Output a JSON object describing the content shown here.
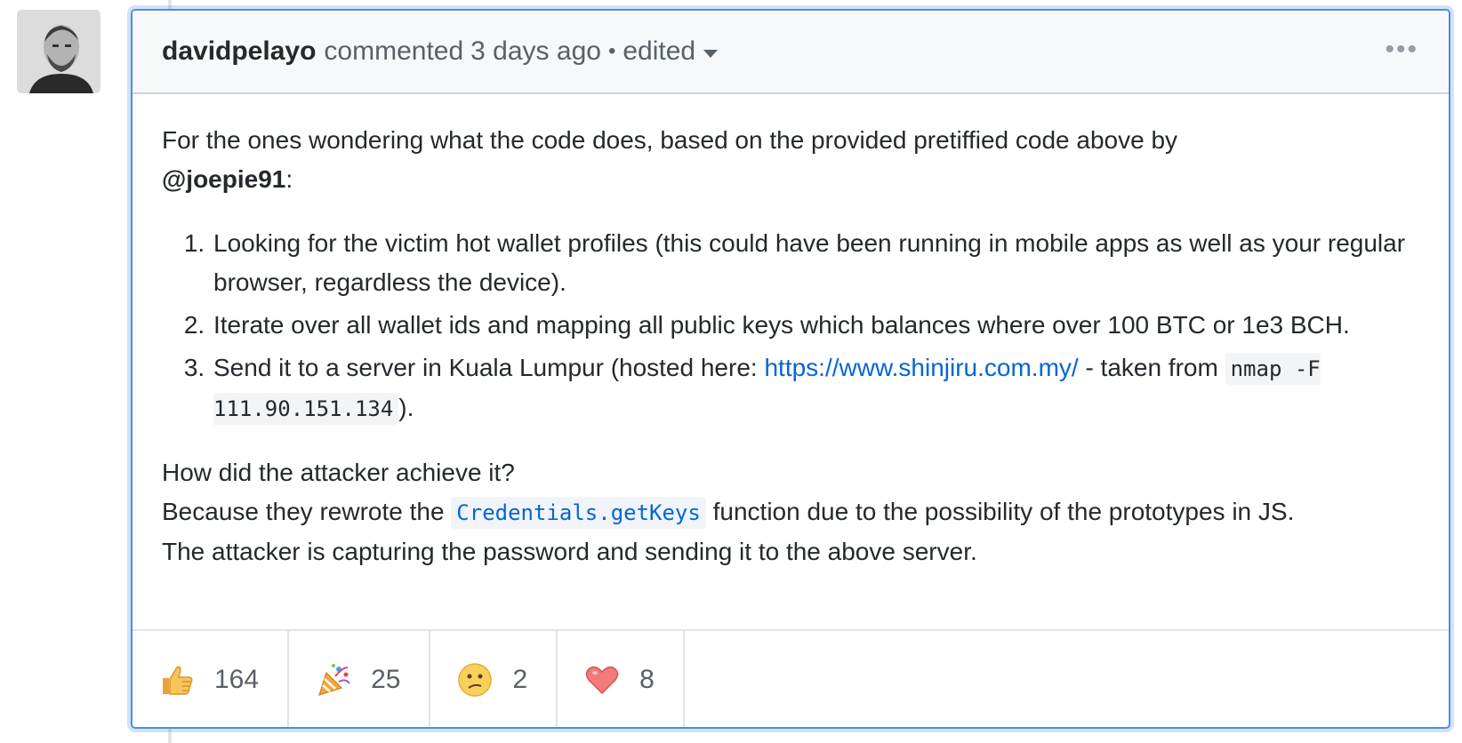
{
  "comment": {
    "author": "davidpelayo",
    "action": "commented",
    "timestamp": "3 days ago",
    "separator": "•",
    "edited_label": "edited",
    "more_icon": "kebab-horizontal-icon",
    "accent_color": "#4a90e2"
  },
  "body": {
    "intro_text": "For the ones wondering what the code does, based on the provided pretiffied code above by",
    "intro_mention": "@joepie91",
    "intro_suffix": ":",
    "steps": [
      {
        "number": "1.",
        "text": "Looking for the victim hot wallet profiles (this could have been running in mobile apps as well as your regular browser, regardless the device)."
      },
      {
        "number": "2.",
        "text": "Iterate over all wallet ids and mapping all public keys which balances where over 100 BTC or 1e3 BCH."
      },
      {
        "number": "3.",
        "text_before": "Send it to a server in Kuala Lumpur (hosted here: ",
        "link": "https://www.shinjiru.com.my/",
        "text_middle": " - taken from ",
        "code": "nmap -F 111.90.151.134",
        "text_after": ")."
      }
    ],
    "question": "How did the attacker achieve it?",
    "answer_before": "Because they rewrote the ",
    "answer_code": "Credentials.getKeys",
    "answer_after": " function due to the possibility of the prototypes in JS.",
    "conclusion": "The attacker is capturing the password and sending it to the above server."
  },
  "reactions": [
    {
      "emoji": "thumbs-up-icon",
      "count": "164"
    },
    {
      "emoji": "party-popper-icon",
      "count": "25"
    },
    {
      "emoji": "confused-face-icon",
      "count": "2"
    },
    {
      "emoji": "heart-icon",
      "count": "8"
    }
  ]
}
